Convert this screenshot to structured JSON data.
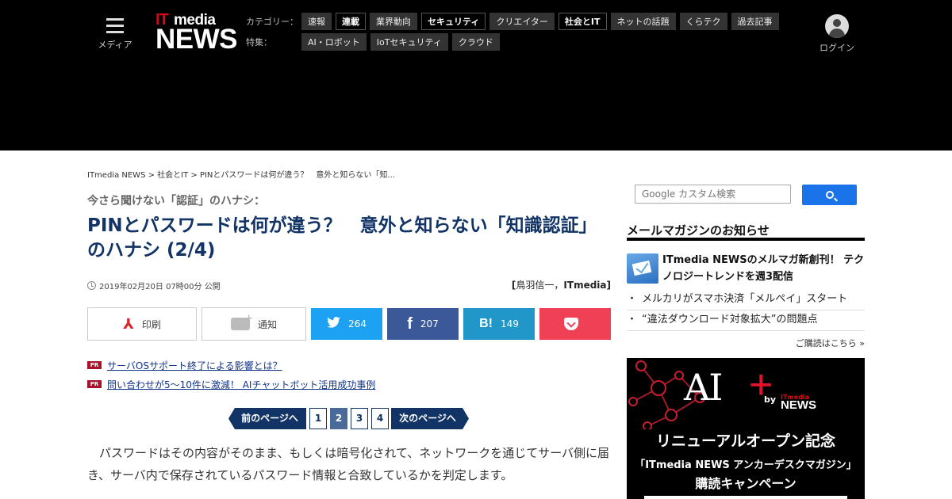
{
  "header": {
    "menu_label": "メディア",
    "logo": {
      "it": "IT",
      "media": "media",
      "news": "NEWS"
    },
    "category_label": "カテゴリー：",
    "categories": [
      {
        "label": "速報",
        "strong": false
      },
      {
        "label": "連載",
        "strong": true
      },
      {
        "label": "業界動向",
        "strong": false
      },
      {
        "label": "セキュリティ",
        "strong": true
      },
      {
        "label": "クリエイター",
        "strong": false
      },
      {
        "label": "社会とIT",
        "strong": true
      },
      {
        "label": "ネットの話題",
        "strong": false
      },
      {
        "label": "くらテク",
        "strong": false
      },
      {
        "label": "過去記事",
        "strong": false
      }
    ],
    "feature_label": "特集：",
    "features": [
      {
        "label": "AI・ロボット"
      },
      {
        "label": "IoTセキュリティ"
      },
      {
        "label": "クラウド"
      }
    ],
    "login_label": "ログイン"
  },
  "article": {
    "breadcrumb": "ITmedia NEWS > 社会とIT > PINとパスワードは何が違う？　意外と知らない「知...",
    "kicker": "今さら聞けない「認証」のハナシ：",
    "title": "PINとパスワードは何が違う？　意外と知らない「知識認証」のハナシ (2/4)",
    "date": "2019年02月20日 07時00分 公開",
    "author_open": "[",
    "author_name": "鳥羽信一",
    "author_sep": "，",
    "author_org": "ITmedia",
    "author_close": "]",
    "body": "パスワードはその内容がそのまま、もしくは暗号化されて、ネットワークを通じてサーバ側に届き、サーバ内で保存されているパスワード情報と合致しているかを判定します。"
  },
  "share": {
    "print_label": "印刷",
    "notify_label": "通知",
    "twitter_count": "264",
    "facebook_count": "207",
    "hatena_count": "149",
    "facebook_glyph": "f",
    "hatena_glyph": "B!"
  },
  "pr": {
    "badge": "PR",
    "items": [
      "サーバOSサポート終了による影響とは？",
      "問い合わせが5～10件に激減！ AIチャットボット活用成功事例"
    ]
  },
  "pager": {
    "prev_label": "前のページへ",
    "next_label": "次のページへ",
    "pages": [
      "1",
      "2",
      "3",
      "4"
    ],
    "current_page": "2"
  },
  "sidebar": {
    "search_placeholder": "Google カスタム検索",
    "mailmag_heading": "メールマガジンのお知らせ",
    "mailmag_main": "ITmedia NEWSのメルマガ新創刊！ テクノロジートレンドを週3配信",
    "mailmag_items": [
      "メルカリがスマホ決済「メルペイ」スタート",
      "“違法ダウンロード対象拡大”の問題点"
    ],
    "mailmag_dot": "・",
    "mailmag_more": "ご購読はこちら »"
  },
  "ad": {
    "ai_text": "AI",
    "plus_text": "+",
    "by_text": "by",
    "brand_it": "ITmedia",
    "brand_news": "NEWS",
    "line1": "リニューアルオープン記念",
    "line2": "「ITmedia NEWS アンカーデスクマガジン」",
    "line3": "購読キャンペーン",
    "accent_color": "#e5112a"
  }
}
